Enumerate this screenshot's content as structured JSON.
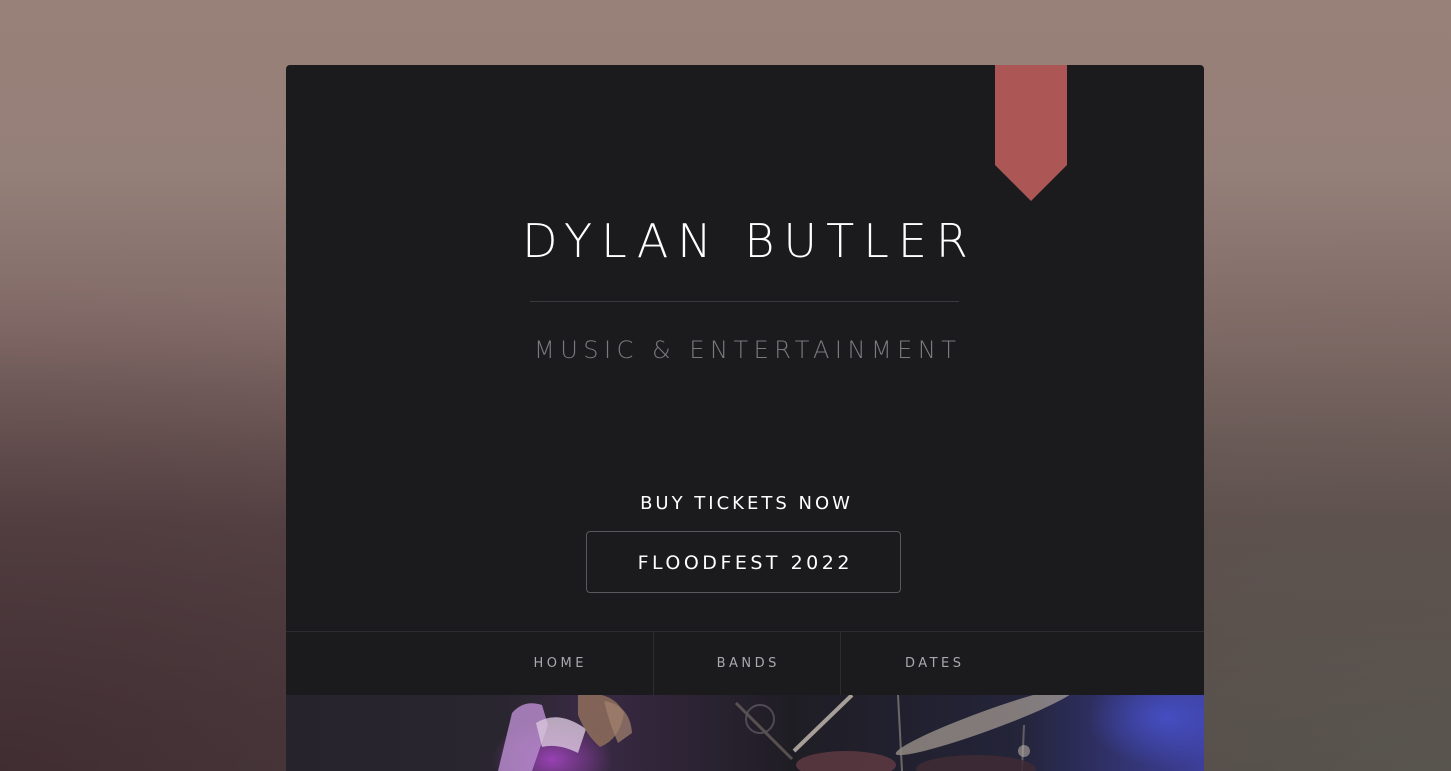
{
  "site": {
    "title": "DYLAN BUTLER",
    "subtitle": "MUSIC & ENTERTAINMENT"
  },
  "cta": {
    "heading": "BUY TICKETS NOW",
    "button_label": "FLOODFEST 2022"
  },
  "nav": {
    "items": [
      {
        "label": "HOME"
      },
      {
        "label": "BANDS"
      },
      {
        "label": "DATES"
      }
    ]
  },
  "colors": {
    "ribbon": "#ac5656",
    "card_background": "#1b1a1d",
    "page_background_top": "#988178",
    "page_background_bottom": "#514245"
  }
}
